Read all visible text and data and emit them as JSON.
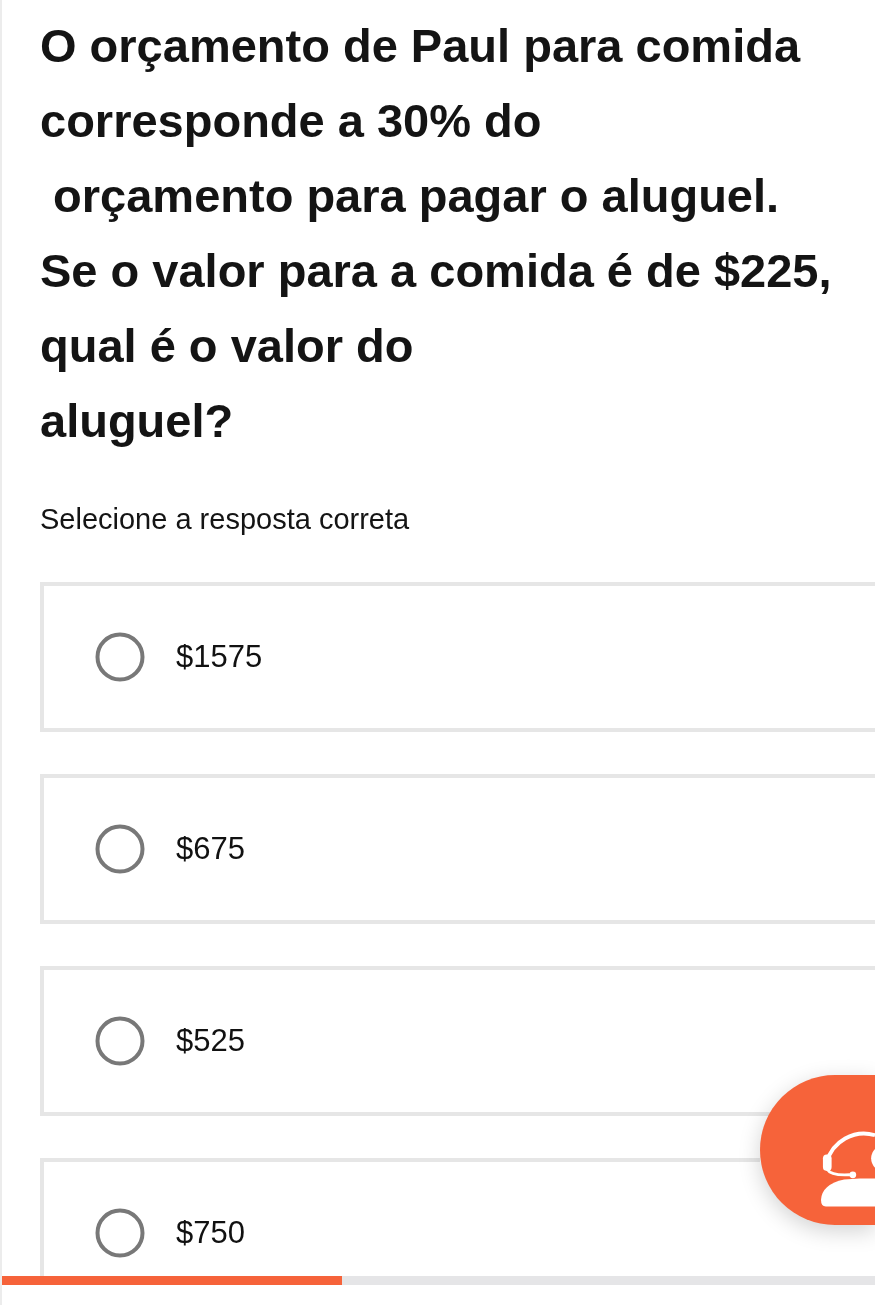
{
  "question": "O orçamento de Paul para comida\ncorresponde a 30% do\n orçamento para pagar o aluguel.\nSe o valor para a comida é de $225,\nqual é o valor do\naluguel?",
  "instruction": "Selecione a resposta correta",
  "options": [
    {
      "label": "$1575",
      "selected": false
    },
    {
      "label": "$675",
      "selected": false
    },
    {
      "label": "$525",
      "selected": false
    },
    {
      "label": "$750",
      "selected": false
    }
  ],
  "progress": {
    "level": 0.39
  }
}
